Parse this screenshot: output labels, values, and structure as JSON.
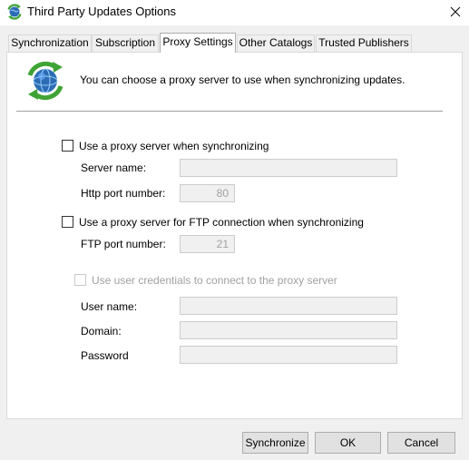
{
  "window": {
    "title": "Third Party Updates Options",
    "app_icon": "sync-globe-icon",
    "close_icon": "close-icon"
  },
  "tabs": [
    {
      "label": "Synchronization",
      "active": false
    },
    {
      "label": "Subscription",
      "active": false
    },
    {
      "label": "Proxy Settings",
      "active": true
    },
    {
      "label": "Other Catalogs",
      "active": false
    },
    {
      "label": "Trusted Publishers",
      "active": false
    }
  ],
  "panel": {
    "icon": "sync-globe-icon",
    "info": "You can choose a proxy server to use when synchronizing updates."
  },
  "proxy": {
    "use_proxy_label": "Use a proxy server when synchronizing",
    "use_proxy_checked": false,
    "server_name_label": "Server name:",
    "server_name_value": "",
    "http_port_label": "Http port number:",
    "http_port_value": "80",
    "use_ftp_label": "Use a proxy server for FTP connection when synchronizing",
    "use_ftp_checked": false,
    "ftp_port_label": "FTP port number:",
    "ftp_port_value": "21",
    "credentials_label": "Use user credentials to connect to the proxy server",
    "credentials_checked": false,
    "username_label": "User name:",
    "username_value": "",
    "domain_label": "Domain:",
    "domain_value": "",
    "password_label": "Password",
    "password_value": ""
  },
  "buttons": {
    "synchronize": "Synchronize",
    "ok": "OK",
    "cancel": "Cancel"
  },
  "colors": {
    "accent_green": "#3ea334",
    "globe_blue": "#2b6cb5",
    "disabled_text": "#a0a0a0"
  }
}
